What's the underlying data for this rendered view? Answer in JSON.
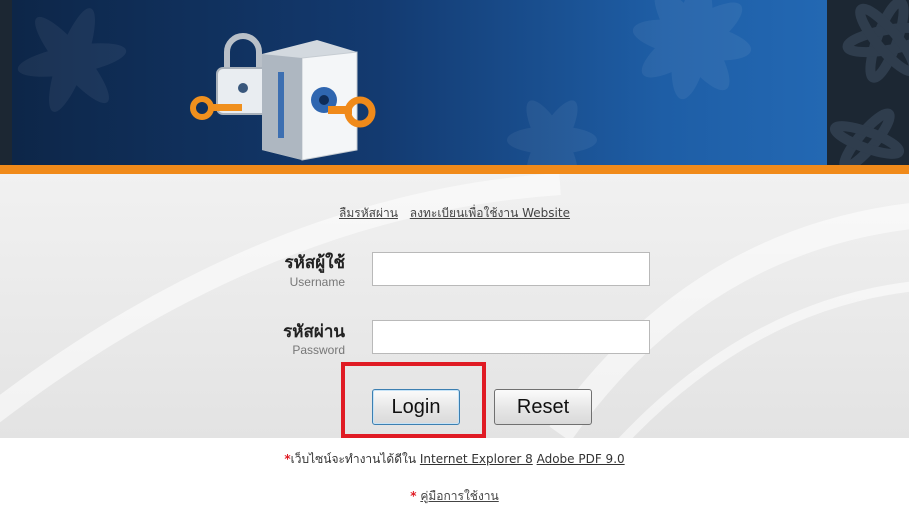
{
  "links": {
    "forgot_password": "ลืมรหัสผ่าน",
    "register": "ลงทะเบียนเพื่อใช้งาน Website"
  },
  "form": {
    "username_label_th": "รหัสผู้ใช้",
    "username_label_en": "Username",
    "username_value": "",
    "password_label_th": "รหัสผ่าน",
    "password_label_en": "Password",
    "password_value": "",
    "login_label": "Login",
    "reset_label": "Reset"
  },
  "notes": {
    "star": "*",
    "browser_note": "เว็บไซน์จะทำงานได้ดีใน",
    "ie_link": "Internet Explorer 8",
    "pdf_link": "Adobe PDF 9.0",
    "manual_star": "*",
    "manual_link": "คู่มือการใช้งาน"
  },
  "icons": {
    "banner_graphic": "padlock-key-icon"
  },
  "colors": {
    "accent_orange": "#f08a1a",
    "highlight_red": "#e01b24",
    "banner_blue": "#133a70"
  }
}
